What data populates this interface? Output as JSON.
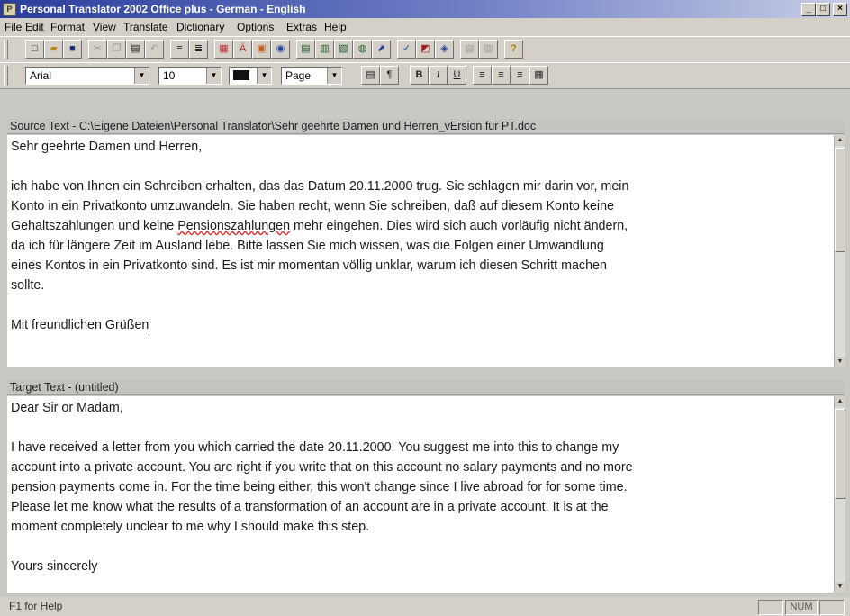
{
  "window": {
    "title": "Personal Translator 2002 Office plus - German - English",
    "icon": "app-icon",
    "controls": [
      "minimize",
      "maximize",
      "close"
    ]
  },
  "menu": [
    "File",
    "Edit",
    "Format",
    "View",
    "Translate",
    "Dictionary",
    "Options",
    "Extras",
    "Help"
  ],
  "format_toolbar": {
    "font": "Arial",
    "size": "10",
    "view": "Page"
  },
  "source": {
    "header": "Source Text - C:\\Eigene Dateien\\Personal Translator\\Sehr geehrte Damen und Herren_vErsion für PT.doc",
    "greeting": "Sehr geehrte Damen und Herren,",
    "lines": [
      "ich habe von Ihnen ein Schreiben erhalten, das das Datum 20.11.2000 trug. Sie schlagen mir darin vor, mein",
      "Konto in ein Privatkonto umzuwandeln. Sie haben recht, wenn Sie schreiben, daß auf diesem Konto keine"
    ],
    "line3_pre": "Gehaltszahlungen und keine ",
    "line3_marked": "Pensionszahlungen",
    "line3_post": " mehr eingehen. Dies wird sich auch vorläufig nicht ändern,",
    "lines_rest": [
      "da ich für längere Zeit im Ausland lebe. Bitte lassen Sie mich wissen, was die Folgen einer Umwandlung",
      "eines Kontos in ein Privatkonto sind. Es ist mir momentan völlig unklar, warum ich diesen Schritt machen",
      "sollte."
    ],
    "closing": "Mit freundlichen Grüßen"
  },
  "target": {
    "header": "Target Text - (untitled)",
    "greeting": "Dear Sir or Madam,",
    "lines": [
      "I have received a letter from you which carried the date 20.11.2000. You suggest me into this to change my",
      "account into a private account. You are right if you write that on this account no salary payments and no more",
      "pension payments come in. For the time being either, this won't change since I live abroad for for some time.",
      "Please let me know what the results of a transformation of an account are in a private account. It is at the",
      "moment completely unclear to me why I should make this step."
    ],
    "closing": "Yours sincerely"
  },
  "status": {
    "help": "F1 for Help",
    "num": "NUM"
  }
}
